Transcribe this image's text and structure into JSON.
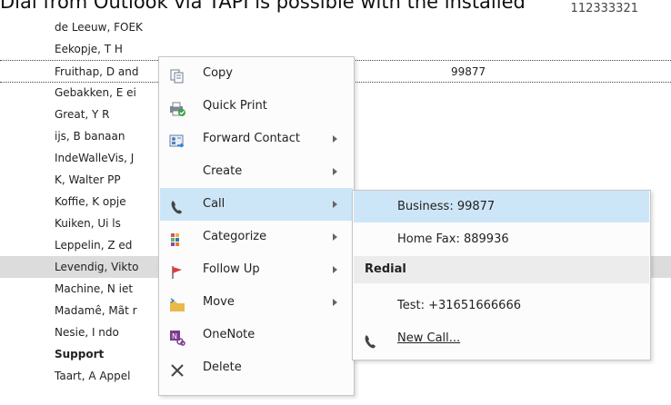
{
  "caption": {
    "text": "Dial from Outlook via TAPI is possible with the installed",
    "right_partial": "112333321"
  },
  "contacts": [
    {
      "name": "de Leeuw, FOEK",
      "phone": ""
    },
    {
      "name": "Eekopje, T H",
      "phone": ""
    },
    {
      "name": "Fruithap, D and",
      "phone": "99877"
    },
    {
      "name": "Gebakken, E ei",
      "phone": ""
    },
    {
      "name": "Great, Y R",
      "phone": ""
    },
    {
      "name": "ijs, B banaan",
      "phone": ""
    },
    {
      "name": "IndeWalleVis, J",
      "phone": ""
    },
    {
      "name": "K, Walter PP",
      "phone": ""
    },
    {
      "name": "Koffie, K opje",
      "phone": ""
    },
    {
      "name": "Kuiken, Ui ls",
      "phone": ""
    },
    {
      "name": "Leppelin, Z ed",
      "phone": ""
    },
    {
      "name": "Levendig, Vikto",
      "phone": ""
    },
    {
      "name": "Machine, N iet",
      "phone": ""
    },
    {
      "name": "Madamê, Mãt r",
      "phone": ""
    },
    {
      "name": "Nesie, I ndo",
      "phone": ""
    },
    {
      "name": "Support",
      "phone": ""
    },
    {
      "name": "Taart, A Appel",
      "phone": ""
    }
  ],
  "context_menu": {
    "items": [
      {
        "label": "Copy",
        "icon": "copy-icon"
      },
      {
        "label": "Quick Print",
        "icon": "quick-print-icon"
      },
      {
        "label": "Forward Contact",
        "icon": "forward-contact-icon"
      },
      {
        "label": "Create",
        "icon": ""
      },
      {
        "label": "Call",
        "icon": "phone-icon"
      },
      {
        "label": "Categorize",
        "icon": "categorize-icon"
      },
      {
        "label": "Follow Up",
        "icon": "flag-icon"
      },
      {
        "label": "Move",
        "icon": "folder-move-icon"
      },
      {
        "label": "OneNote",
        "icon": "onenote-icon"
      },
      {
        "label": "Delete",
        "icon": "delete-icon"
      }
    ]
  },
  "call_submenu": {
    "business": "Business: 99877",
    "home_fax": "Home Fax: 889936",
    "redial_header": "Redial",
    "redial_item": "Test: +31651666666",
    "new_call": "New Call..."
  },
  "colors": {
    "hover": "#cde6f7",
    "selected_row": "#dcdcdc",
    "flag": "#e0393e",
    "folder": "#e9b949"
  }
}
